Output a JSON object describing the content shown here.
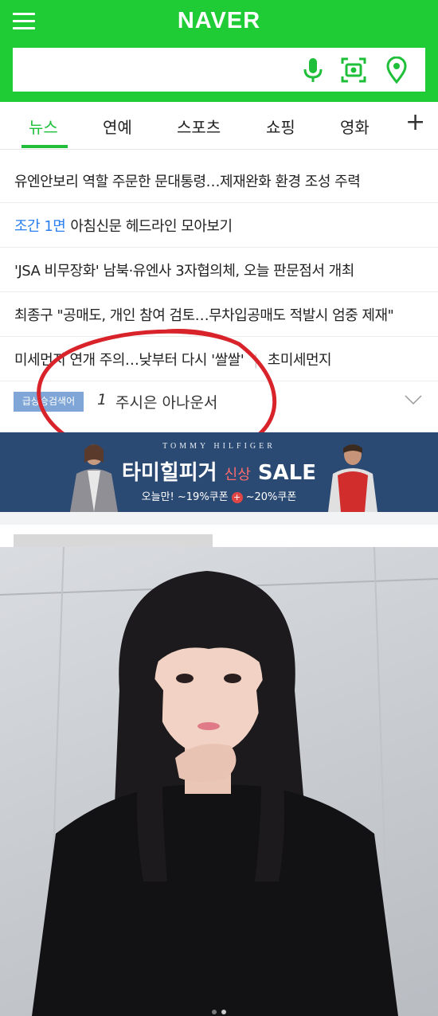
{
  "header": {
    "logo": "NAVER",
    "search": {
      "value": "",
      "placeholder": ""
    },
    "icons": [
      "hamburger-menu-icon",
      "microphone-icon",
      "lens-camera-icon",
      "location-pin-icon"
    ],
    "colors": {
      "brand": "#1fcc35",
      "icon_green": "#1fbf3a"
    }
  },
  "tabs": {
    "items": [
      {
        "label": "뉴스",
        "active": true
      },
      {
        "label": "연예"
      },
      {
        "label": "스포츠"
      },
      {
        "label": "쇼핑"
      },
      {
        "label": "영화"
      }
    ],
    "more": "+"
  },
  "news": [
    {
      "text": "유엔안보리 역할 주문한 문대통령…제재완화 환경 조성 주력"
    },
    {
      "prefix": "조간 1면",
      "text": "아침신문 헤드라인 모아보기"
    },
    {
      "text": "'JSA 비무장화' 남북·유엔사 3자협의체, 오늘 판문점서 개최"
    },
    {
      "text": "최종구 \"공매도, 개인 참여 검토…무차입공매도 적발시 엄중 제재\""
    },
    {
      "text": "미세먼지 연개 주의…낮부터 다시 '쌀쌀'",
      "extra": "초미세먼지"
    }
  ],
  "trending": {
    "badge": "급상승검색어",
    "rank": "1",
    "keyword": "주시은 아나운서"
  },
  "banner": {
    "brand": "TOMMY HILFIGER",
    "title": "타미힐피거",
    "title_sub": "신상",
    "sale": "SALE",
    "coupon_left": "오늘만! ~19%쿠폰",
    "coupon_plus": "+",
    "coupon_right": "~20%쿠폰",
    "colors": {
      "background": "#2b4a73"
    }
  },
  "annotation": {
    "shape": "hand-drawn red ellipse around trending keyword",
    "color": "#d8232a"
  },
  "carousel": {
    "pages": 2,
    "active": 1
  }
}
